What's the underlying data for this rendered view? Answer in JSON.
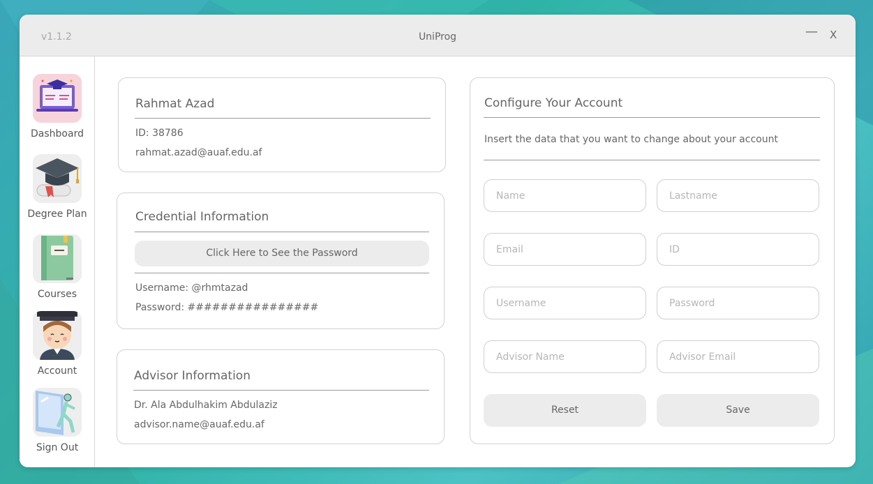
{
  "window": {
    "version": "v1.1.2",
    "title": "UniProg",
    "minimize_label": "—",
    "close_label": "X"
  },
  "sidebar": {
    "items": [
      {
        "label": "Dashboard",
        "icon": "dashboard-icon"
      },
      {
        "label": "Degree Plan",
        "icon": "graduation-cap-icon"
      },
      {
        "label": "Courses",
        "icon": "notebook-icon"
      },
      {
        "label": "Account",
        "icon": "student-avatar-icon"
      },
      {
        "label": "Sign Out",
        "icon": "exit-door-icon"
      }
    ]
  },
  "profile": {
    "name": "Rahmat Azad",
    "id_line": "ID: 38786",
    "email": "rahmat.azad@auaf.edu.af"
  },
  "credentials": {
    "title": "Credential Information",
    "show_password_button": "Click Here to See the Password",
    "username_line": "Username: @rhmtazad",
    "password_line": "Password: ################"
  },
  "advisor": {
    "title": "Advisor Information",
    "name": "Dr. Ala Abdulhakim Abdulaziz",
    "email": "advisor.name@auaf.edu.af"
  },
  "configure": {
    "title": "Configure Your Account",
    "subtitle": "Insert the data that you want to change about your account",
    "fields": {
      "name": "Name",
      "lastname": "Lastname",
      "email": "Email",
      "id": "ID",
      "username": "Username",
      "password": "Password",
      "advisor_name": "Advisor Name",
      "advisor_email": "Advisor Email"
    },
    "reset_label": "Reset",
    "save_label": "Save"
  },
  "colors": {
    "accent_bg": "#2fb3a7",
    "panel_border": "#d2d2d2",
    "button_bg": "#ececec"
  }
}
